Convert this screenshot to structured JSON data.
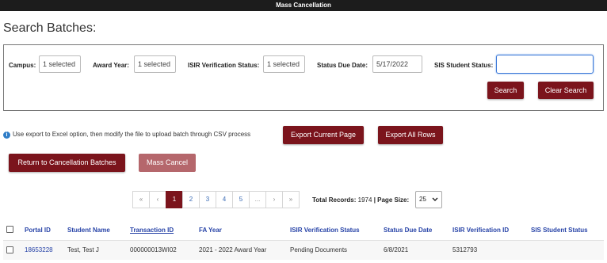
{
  "window": {
    "title": "Mass Cancellation"
  },
  "page": {
    "heading": "Search Batches:"
  },
  "search": {
    "campus_label": "Campus:",
    "campus_value": "1 selected",
    "award_year_label": "Award Year:",
    "award_year_value": "1 selected",
    "isir_status_label": "ISIR Verification Status:",
    "isir_status_value": "1 selected",
    "status_due_date_label": "Status Due Date:",
    "status_due_date_value": "5/17/2022",
    "sis_student_status_label": "SIS Student Status:",
    "sis_student_status_value": "",
    "search_button": "Search",
    "clear_search_button": "Clear Search"
  },
  "info": {
    "icon": "info-icon",
    "text": "Use export to Excel option, then modify the file to upload batch through CSV process"
  },
  "actions": {
    "export_current_page": "Export Current Page",
    "export_all_rows": "Export All Rows",
    "return_to_batches": "Return to Cancellation Batches",
    "mass_cancel": "Mass Cancel"
  },
  "pagination": {
    "first": "«",
    "prev": "‹",
    "pages": [
      "1",
      "2",
      "3",
      "4",
      "5",
      "..."
    ],
    "next": "›",
    "last": "»",
    "current_page": "1",
    "total_records_label": "Total Records:",
    "total_records": "1974",
    "page_size_label": "| Page Size:",
    "page_size": "25"
  },
  "table": {
    "columns": [
      "Portal ID",
      "Student Name",
      "Transaction ID",
      "FA Year",
      "ISIR Verification Status",
      "Status Due Date",
      "ISIR Verification ID",
      "SIS Student Status"
    ],
    "rows": [
      {
        "portal_id": "18653228",
        "student_name": "Test, Test J",
        "transaction_id": "000000013WI02",
        "fa_year": "2021 - 2022 Award Year",
        "isir_status": "Pending Documents",
        "status_due_date": "6/8/2021",
        "isir_verification_id": "5312793",
        "sis_student_status": ""
      }
    ]
  },
  "colors": {
    "accent": "#7b141c",
    "link": "#2743a7",
    "titlebar": "#1c1c1c"
  }
}
